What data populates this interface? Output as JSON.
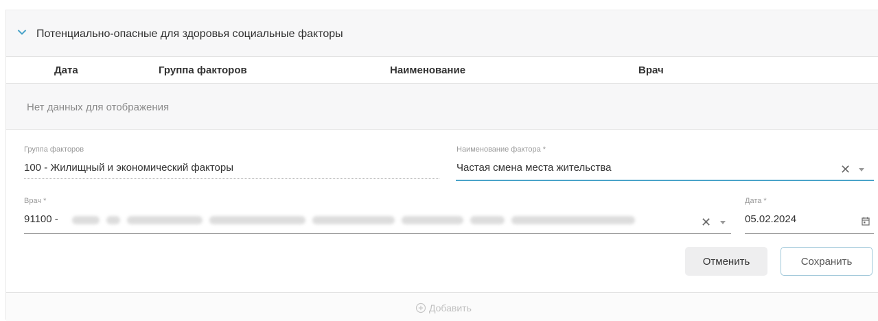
{
  "section": {
    "title": "Потенциально-опасные для здоровья социальные факторы"
  },
  "table": {
    "columns": [
      "Дата",
      "Группа факторов",
      "Наименование",
      "Врач"
    ],
    "empty_text": "Нет данных для отображения"
  },
  "form": {
    "factor_group": {
      "label": "Группа факторов",
      "value": "100 - Жилищный и экономический факторы"
    },
    "factor_name": {
      "label": "Наименование фактора *",
      "value": "Частая смена места жительства"
    },
    "doctor": {
      "label": "Врач *",
      "value": "91100 -"
    },
    "date": {
      "label": "Дата *",
      "value": "05.02.2024"
    },
    "cancel_label": "Отменить",
    "save_label": "Сохранить"
  },
  "footer": {
    "add_label": "Добавить"
  },
  "icons": {
    "expand": "chevron-down-icon",
    "clear": "close-icon",
    "dropdown": "caret-down-icon",
    "calendar": "calendar-icon",
    "add": "plus-circle-icon"
  },
  "colors": {
    "accent": "#4aa3c9",
    "header_bg": "#f7f7f8"
  }
}
